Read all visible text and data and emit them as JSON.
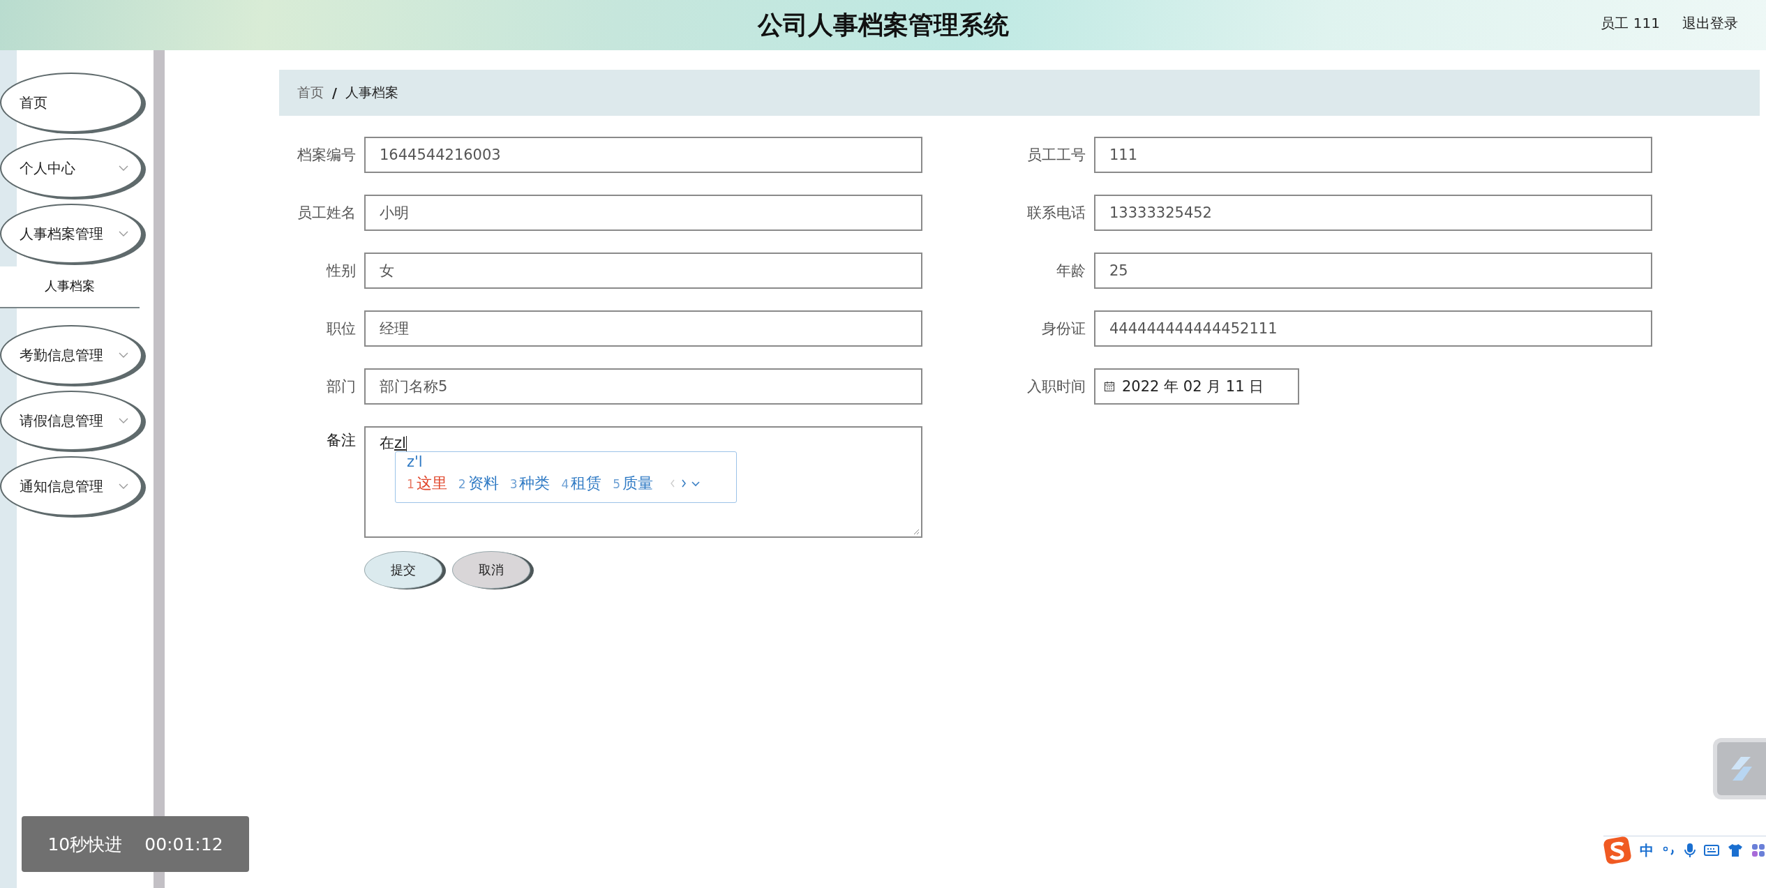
{
  "header": {
    "title": "公司人事档案管理系统",
    "user": "员工 111",
    "logout": "退出登录"
  },
  "sidebar": {
    "items": [
      {
        "label": "首页",
        "has_arrow": false
      },
      {
        "label": "个人中心",
        "has_arrow": true
      },
      {
        "label": "人事档案管理",
        "has_arrow": true,
        "children": [
          {
            "label": "人事档案",
            "selected": true
          }
        ]
      },
      {
        "label": "考勤信息管理",
        "has_arrow": true
      },
      {
        "label": "请假信息管理",
        "has_arrow": true
      },
      {
        "label": "通知信息管理",
        "has_arrow": true
      }
    ]
  },
  "breadcrumb": {
    "items": [
      "首页",
      "人事档案"
    ],
    "separator": "/"
  },
  "form": {
    "rows": [
      [
        {
          "label": "档案编号",
          "value": "1644544216003",
          "kind": "text"
        },
        {
          "label": "员工工号",
          "value": "111",
          "kind": "text"
        }
      ],
      [
        {
          "label": "员工姓名",
          "value": "小明",
          "kind": "text"
        },
        {
          "label": "联系电话",
          "value": "13333325452",
          "kind": "text"
        }
      ],
      [
        {
          "label": "性别",
          "value": "女",
          "kind": "text"
        },
        {
          "label": "年龄",
          "value": "25",
          "kind": "text"
        }
      ],
      [
        {
          "label": "职位",
          "value": "经理",
          "kind": "text"
        },
        {
          "label": "身份证",
          "value": "444444444444452111",
          "kind": "text"
        }
      ],
      [
        {
          "label": "部门",
          "value": "部门名称5",
          "kind": "text"
        },
        {
          "label": "入职时间",
          "value": "2022 年 02 月 11 日",
          "kind": "date"
        }
      ]
    ],
    "remark": {
      "label": "备注",
      "value": "在",
      "composition": "zl"
    },
    "buttons": [
      {
        "label": "提交",
        "kind": "primary"
      },
      {
        "label": "取消",
        "kind": "secondary"
      }
    ]
  },
  "ime_popup": {
    "input": "z'l",
    "candidates": [
      {
        "index": "1",
        "text": "这里",
        "selected": true
      },
      {
        "index": "2",
        "text": "资料",
        "selected": false
      },
      {
        "index": "3",
        "text": "种类",
        "selected": false
      },
      {
        "index": "4",
        "text": "租赁",
        "selected": false
      },
      {
        "index": "5",
        "text": "质量",
        "selected": false
      }
    ]
  },
  "ime_toolbar": {
    "mode": "中"
  },
  "video_overlay": {
    "label": "10秒快进",
    "time": "00:01:12"
  }
}
